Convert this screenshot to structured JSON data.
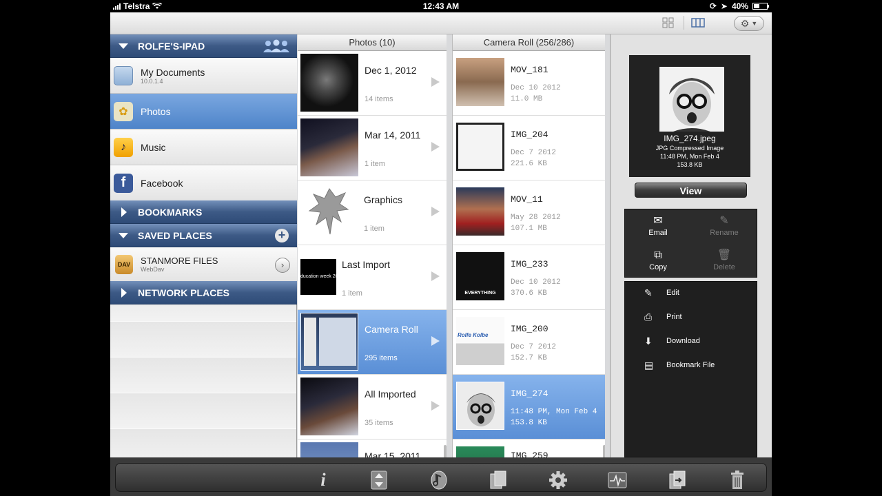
{
  "status_bar": {
    "carrier": "Telstra",
    "time": "12:43 AM",
    "battery": "40%"
  },
  "toolbar": {
    "view_grid_icon": "grid-icon",
    "view_columns_icon": "columns-icon",
    "settings_icon": "gear-icon"
  },
  "sidebar": {
    "device_header": "ROLFE'S-IPAD",
    "items": [
      {
        "label": "My Documents",
        "sub": "10.0.1.4",
        "icon": "folder-icon"
      },
      {
        "label": "Photos",
        "sub": "",
        "icon": "sunflower-icon"
      },
      {
        "label": "Music",
        "sub": "",
        "icon": "music-note-icon"
      },
      {
        "label": "Facebook",
        "sub": "",
        "icon": "facebook-icon"
      }
    ],
    "bookmarks_header": "BOOKMARKS",
    "saved_places_header": "SAVED PLACES",
    "saved_place": {
      "label": "STANMORE FILES",
      "sub": "WebDav",
      "badge": "DAV"
    },
    "network_header": "NETWORK PLACES"
  },
  "photos_column": {
    "header": "Photos (10)",
    "rows": [
      {
        "name": "Dec 1, 2012",
        "sub": "14 items"
      },
      {
        "name": "Mar 14, 2011",
        "sub": "1 item"
      },
      {
        "name": "Graphics",
        "sub": "1 item"
      },
      {
        "name": "Last Import",
        "sub": "1 item",
        "thumb_text": "ducation week 20"
      },
      {
        "name": "Camera Roll",
        "sub": "295 items"
      },
      {
        "name": "All Imported",
        "sub": "35 items"
      },
      {
        "name": "Mar 15, 2011",
        "sub": ""
      }
    ]
  },
  "camera_column": {
    "header": "Camera Roll (256/286)",
    "rows": [
      {
        "name": "MOV_181",
        "date": "Dec 10 2012",
        "size": "11.0  MB"
      },
      {
        "name": "IMG_204",
        "date": "Dec 7 2012",
        "size": "221.6  KB"
      },
      {
        "name": "MOV_11",
        "date": "May 28 2012",
        "size": "107.1  MB"
      },
      {
        "name": "IMG_233",
        "date": "Dec 10 2012",
        "size": "370.6  KB",
        "thumb_text": "EVERYTHING"
      },
      {
        "name": "IMG_200",
        "date": "Dec 7 2012",
        "size": "152.7  KB",
        "thumb_text": "Rolfe Kolbe"
      },
      {
        "name": "IMG_274",
        "date": "11:48 PM, Mon Feb 4",
        "size": "153.8  KB"
      },
      {
        "name": "IMG_259",
        "date": "",
        "size": ""
      }
    ]
  },
  "detail": {
    "file_name": "IMG_274.jpeg",
    "file_type": "JPG Compressed Image",
    "file_date": "11:48 PM, Mon Feb 4",
    "file_size": "153.8 KB",
    "view_label": "View",
    "actions": {
      "email": "Email",
      "rename": "Rename",
      "copy": "Copy",
      "delete": "Delete"
    },
    "menu": {
      "edit": "Edit",
      "print": "Print",
      "download": "Download",
      "bookmark": "Bookmark File"
    }
  },
  "bottom_bar": {
    "icons": [
      "info-icon",
      "sort-icon",
      "music-icon",
      "copy-icon",
      "settings-icon",
      "activity-icon",
      "transfer-icon",
      "trash-icon"
    ],
    "info_glyph": "i"
  },
  "colors": {
    "header_blue": "#3d5a86",
    "selected_blue": "#5a8fd6",
    "panel_dark": "#2c2c2c"
  }
}
